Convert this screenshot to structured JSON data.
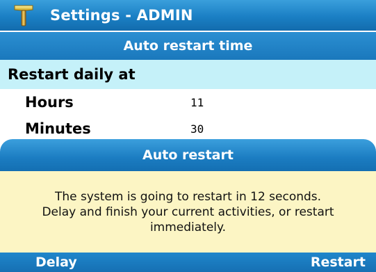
{
  "window": {
    "title": "Settings - ADMIN",
    "icon": "tools-icon"
  },
  "section": {
    "title": "Auto restart time"
  },
  "restart": {
    "label": "Restart daily at",
    "fields": [
      {
        "label": "Hours",
        "value": "11"
      },
      {
        "label": "Minutes",
        "value": "30"
      }
    ]
  },
  "dialog": {
    "title": "Auto restart",
    "message_lines": [
      "The system is going to restart in 12 seconds.",
      "Delay and finish your current activities, or restart",
      "immediately."
    ]
  },
  "softkeys": {
    "left": "Delay",
    "right": "Restart"
  },
  "colors": {
    "header_blue": "#1a7fc4",
    "row_highlight": "#c5f1f9",
    "dialog_body": "#fcf5c4"
  }
}
